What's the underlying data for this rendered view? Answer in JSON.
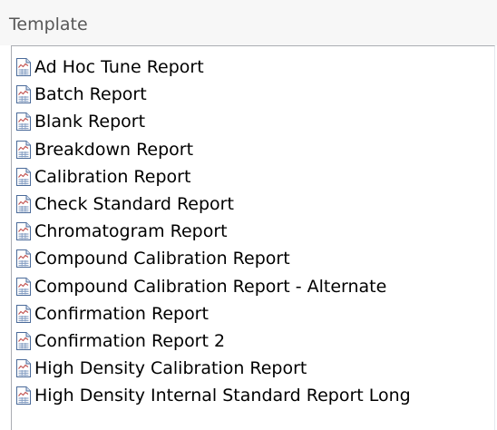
{
  "group": {
    "title": "Template"
  },
  "templates": [
    "Ad Hoc Tune Report",
    "Batch Report",
    "Blank Report",
    "Breakdown Report",
    "Calibration Report",
    "Check Standard Report",
    "Chromatogram Report",
    "Compound Calibration Report",
    "Compound Calibration Report - Alternate",
    "Confirmation Report",
    "Confirmation Report 2",
    "High Density Calibration Report",
    "High Density Internal Standard Report Long"
  ],
  "icon": "report-template-icon",
  "colors": {
    "header_background": "#f7f7f7",
    "title_text": "#585858",
    "list_border": "#abadb3",
    "icon_stroke": "#4b6b9a"
  }
}
